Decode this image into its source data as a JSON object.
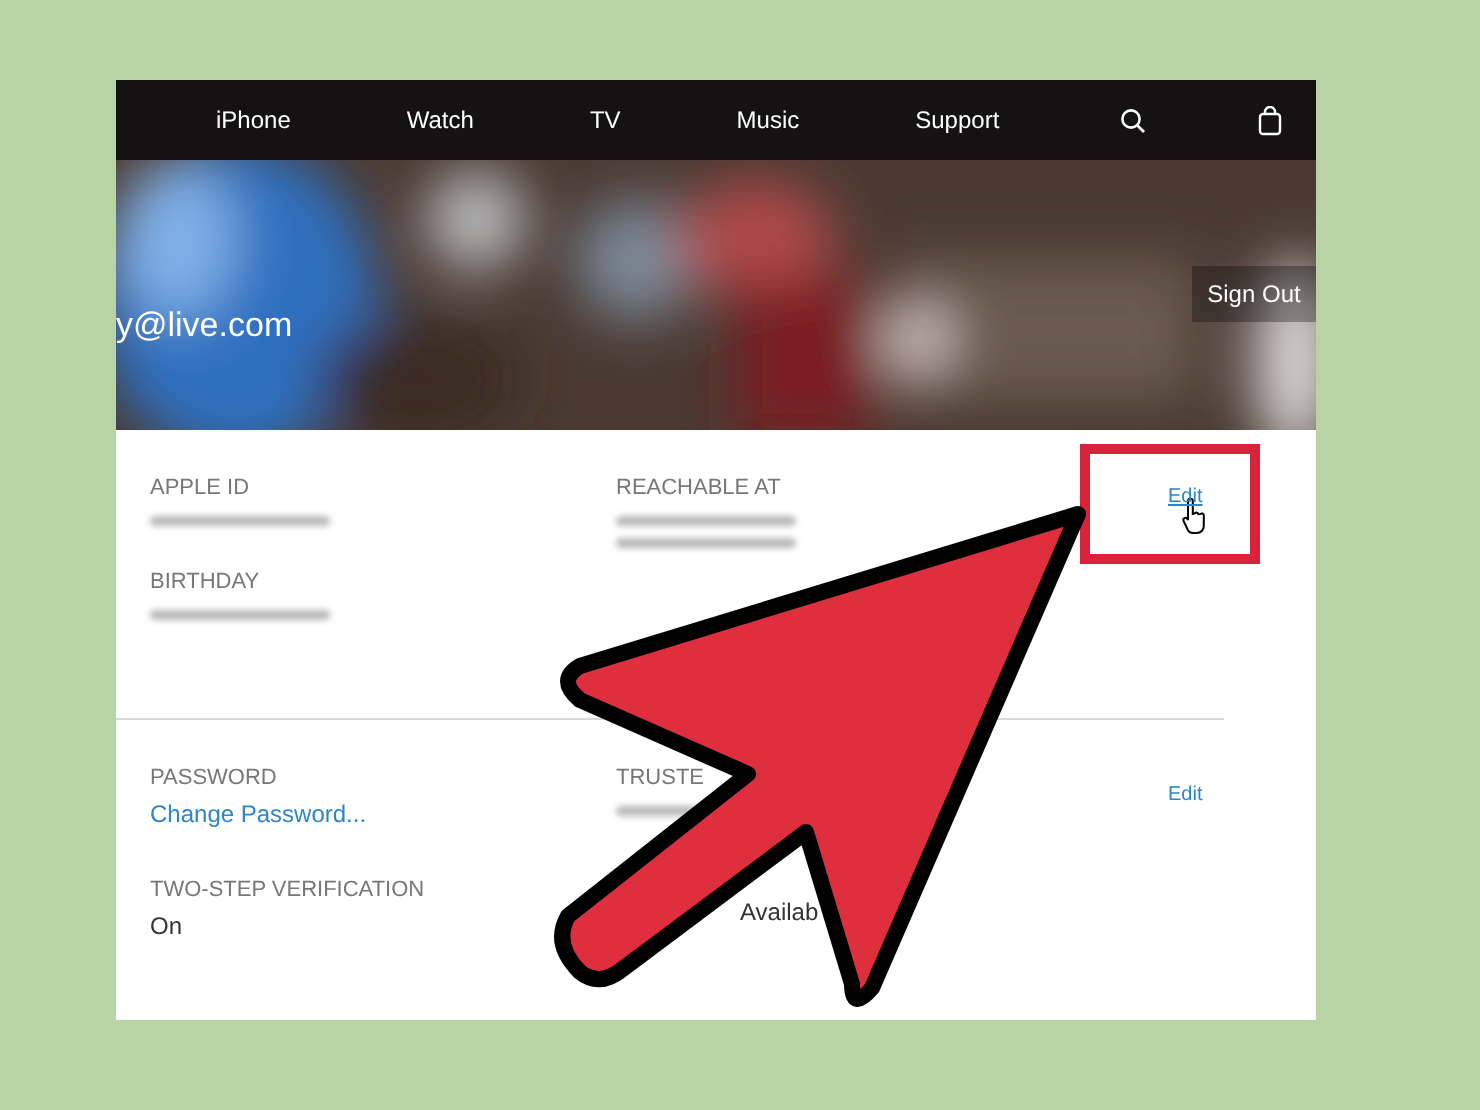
{
  "nav": {
    "items": [
      "iPhone",
      "Watch",
      "TV",
      "Music",
      "Support"
    ]
  },
  "hero": {
    "kind": "picture",
    "email": "y@live.com",
    "sign_out": "Sign Out"
  },
  "sections": [
    {
      "edit": "Edit",
      "highlighted": true,
      "columns": [
        [
          {
            "label": "APPLE ID",
            "values": [
              {
                "kind": "redacted"
              }
            ]
          },
          {
            "label": "BIRTHDAY",
            "values": [
              {
                "kind": "redacted"
              }
            ]
          }
        ],
        [
          {
            "label": "REACHABLE AT",
            "values": [
              {
                "kind": "redacted"
              },
              {
                "kind": "redacted"
              }
            ]
          }
        ]
      ]
    },
    {
      "edit": "Edit",
      "highlighted": false,
      "columns": [
        [
          {
            "label": "PASSWORD",
            "values": [
              {
                "kind": "link",
                "text": "Change Password..."
              }
            ]
          },
          {
            "label": "TWO-STEP VERIFICATION",
            "values": [
              {
                "kind": "text",
                "text": "On"
              }
            ]
          }
        ],
        [
          {
            "label": "TRUSTE",
            "values": [
              {
                "kind": "redacted"
              }
            ]
          },
          {
            "values": [
              {
                "kind": "text",
                "text": "Availab"
              }
            ]
          }
        ]
      ]
    }
  ]
}
